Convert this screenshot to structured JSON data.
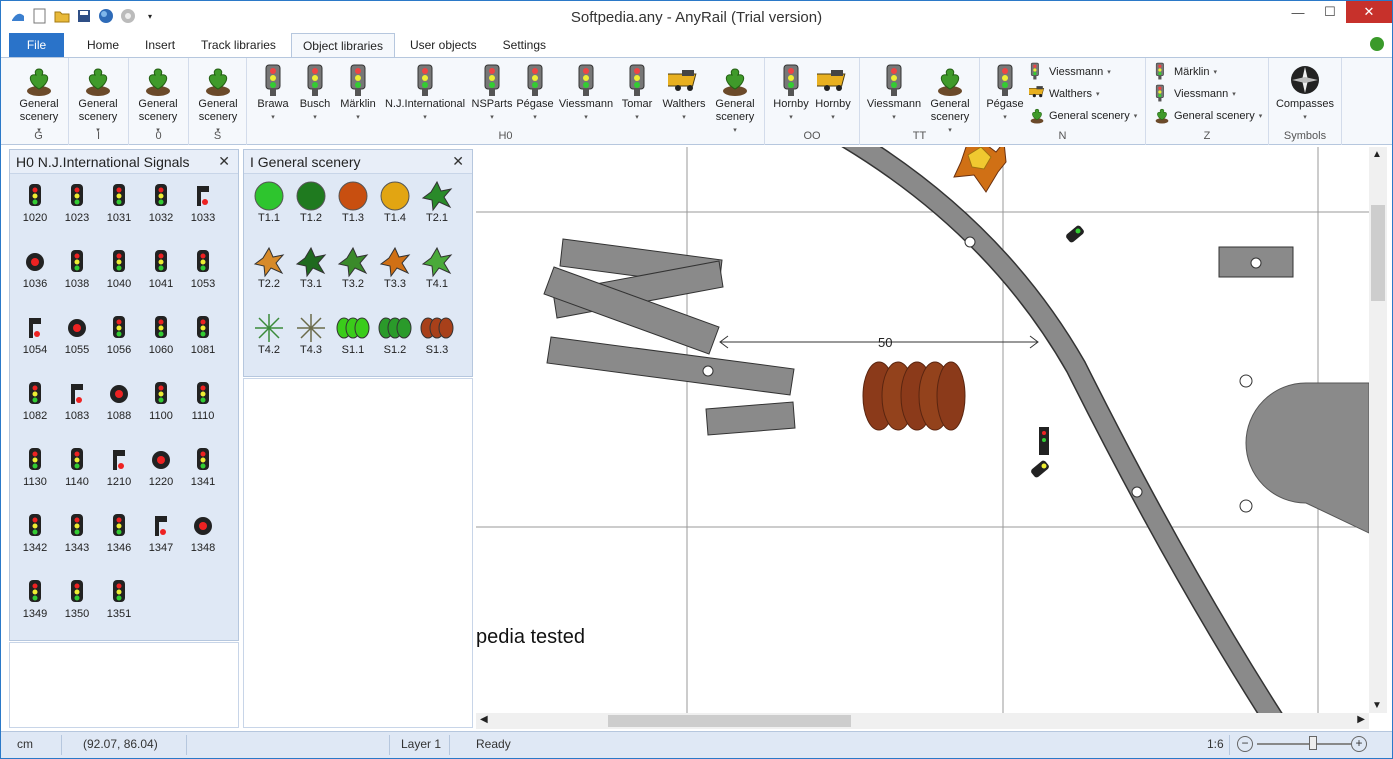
{
  "window": {
    "title": "Softpedia.any - AnyRail (Trial version)",
    "minimize": "—",
    "maximize": "☐",
    "close": "✕"
  },
  "tabs": [
    {
      "label": "File"
    },
    {
      "label": "Home"
    },
    {
      "label": "Insert"
    },
    {
      "label": "Track libraries"
    },
    {
      "label": "Object libraries"
    },
    {
      "label": "User objects"
    },
    {
      "label": "Settings"
    }
  ],
  "ribbon": {
    "groups": [
      {
        "name": "G",
        "buttons": [
          {
            "label": "General scenery"
          }
        ]
      },
      {
        "name": "I",
        "buttons": [
          {
            "label": "General scenery"
          }
        ]
      },
      {
        "name": "0",
        "buttons": [
          {
            "label": "General scenery"
          }
        ]
      },
      {
        "name": "S",
        "buttons": [
          {
            "label": "General scenery"
          }
        ]
      },
      {
        "name": "H0",
        "buttons": [
          {
            "label": "Brawa"
          },
          {
            "label": "Busch"
          },
          {
            "label": "Märklin"
          },
          {
            "label": "N.J.International"
          },
          {
            "label": "NSParts"
          },
          {
            "label": "Pégase"
          },
          {
            "label": "Viessmann"
          },
          {
            "label": "Tomar"
          },
          {
            "label": "Walthers"
          },
          {
            "label": "General scenery"
          }
        ]
      },
      {
        "name": "OO",
        "buttons": [
          {
            "label": "Hornby"
          },
          {
            "label": "Hornby"
          }
        ]
      },
      {
        "name": "TT",
        "buttons": [
          {
            "label": "Viessmann"
          },
          {
            "label": "General scenery"
          }
        ]
      },
      {
        "name": "N",
        "buttons": [
          {
            "label": "Pégase"
          }
        ],
        "small": [
          {
            "label": "Viessmann"
          },
          {
            "label": "Walthers"
          },
          {
            "label": "General scenery"
          }
        ]
      },
      {
        "name": "Z",
        "small": [
          {
            "label": "Märklin"
          },
          {
            "label": "Viessmann"
          },
          {
            "label": "General scenery"
          }
        ]
      },
      {
        "name": "Symbols",
        "buttons": [
          {
            "label": "Compasses"
          }
        ]
      }
    ]
  },
  "signals_panel": {
    "title": "H0 N.J.International Signals",
    "items": [
      "1020",
      "1023",
      "1031",
      "1032",
      "1033",
      "1036",
      "1038",
      "1040",
      "1041",
      "1053",
      "1054",
      "1055",
      "1056",
      "1060",
      "1081",
      "1082",
      "1083",
      "1088",
      "1100",
      "1110",
      "1130",
      "1140",
      "1210",
      "1220",
      "1341",
      "1342",
      "1343",
      "1346",
      "1347",
      "1348",
      "1349",
      "1350",
      "1351"
    ]
  },
  "scenery_panel": {
    "title": "I General scenery",
    "items": [
      "T1.1",
      "T1.2",
      "T1.3",
      "T1.4",
      "T2.1",
      "T2.2",
      "T3.1",
      "T3.2",
      "T3.3",
      "T4.1",
      "T4.2",
      "T4.3",
      "S1.1",
      "S1.2",
      "S1.3"
    ]
  },
  "canvas": {
    "dimension_label": "50",
    "watermark_text": "pedia tested"
  },
  "status": {
    "unit": "cm",
    "coords": "(92.07, 86.04)",
    "layer": "Layer 1",
    "state": "Ready",
    "zoom": "1:6",
    "zoom_level": 0.6
  },
  "colors": {
    "accent": "#2a73c9",
    "panel": "#dfe8f5",
    "track": "#8a8a8a"
  }
}
